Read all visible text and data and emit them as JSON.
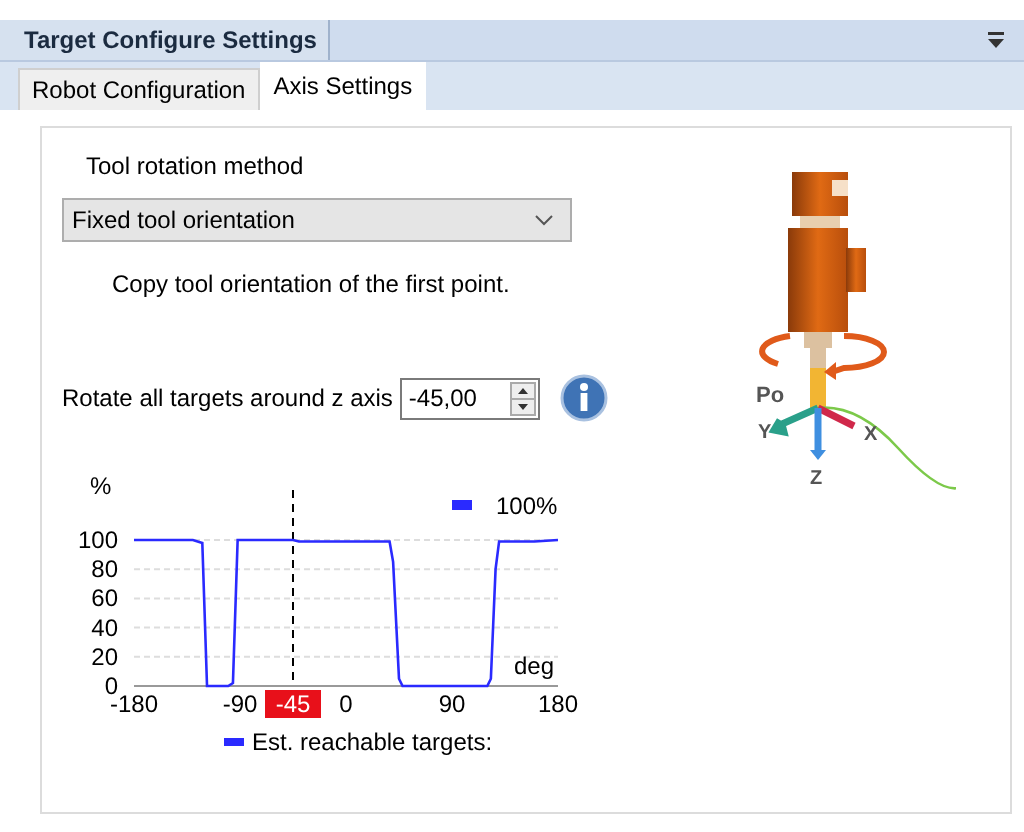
{
  "window": {
    "title": "Target Configure Settings"
  },
  "tabs": [
    {
      "label": "Robot Configuration",
      "selected": false
    },
    {
      "label": "Axis Settings",
      "selected": true
    }
  ],
  "rotation_method": {
    "label": "Tool rotation method",
    "value": "Fixed tool orientation",
    "description": "Copy tool orientation of the first point."
  },
  "rotate_z": {
    "label": "Rotate all targets around z axis",
    "value": "-45,00"
  },
  "illustration": {
    "point_label": "Po",
    "axis_labels": [
      "Y",
      "X",
      "Z"
    ]
  },
  "chart_data": {
    "type": "line",
    "ylabel": "%",
    "xlabel": "deg",
    "xlim": [
      -180,
      180
    ],
    "ylim": [
      0,
      100
    ],
    "xticks": [
      -180,
      -90,
      0,
      90,
      180
    ],
    "yticks": [
      0,
      20,
      40,
      60,
      80,
      100
    ],
    "x": [
      -180,
      -130,
      -122,
      -118,
      -100,
      -96,
      -92,
      -45,
      -40,
      0,
      37,
      40,
      45,
      48,
      120,
      123,
      127,
      130,
      160,
      180
    ],
    "series": [
      {
        "name": "Est. reachable targets:",
        "color": "#2a2aff",
        "values": [
          100,
          100,
          98,
          0,
          0,
          2,
          100,
          100,
          99,
          99,
          99,
          85,
          5,
          0,
          0,
          5,
          80,
          99,
          99,
          100
        ]
      }
    ],
    "grid": true,
    "ref_lines": [
      {
        "axis": "x",
        "value": -45,
        "label": "-45"
      }
    ],
    "annotations": [
      {
        "text": "100%"
      }
    ]
  }
}
